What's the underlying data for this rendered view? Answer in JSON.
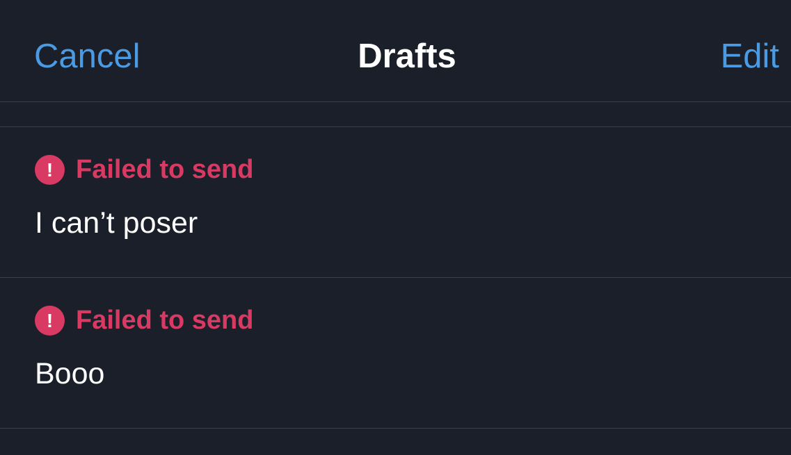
{
  "navbar": {
    "cancel_label": "Cancel",
    "title": "Drafts",
    "edit_label": "Edit"
  },
  "drafts": [
    {
      "status": "Failed to send",
      "status_icon": "alert-icon",
      "text": "I can’t poser"
    },
    {
      "status": "Failed to send",
      "status_icon": "alert-icon",
      "text": "Booo"
    }
  ],
  "colors": {
    "background": "#1a1f29",
    "accent": "#4a9be3",
    "error": "#d83a63",
    "separator": "#3a404b"
  }
}
